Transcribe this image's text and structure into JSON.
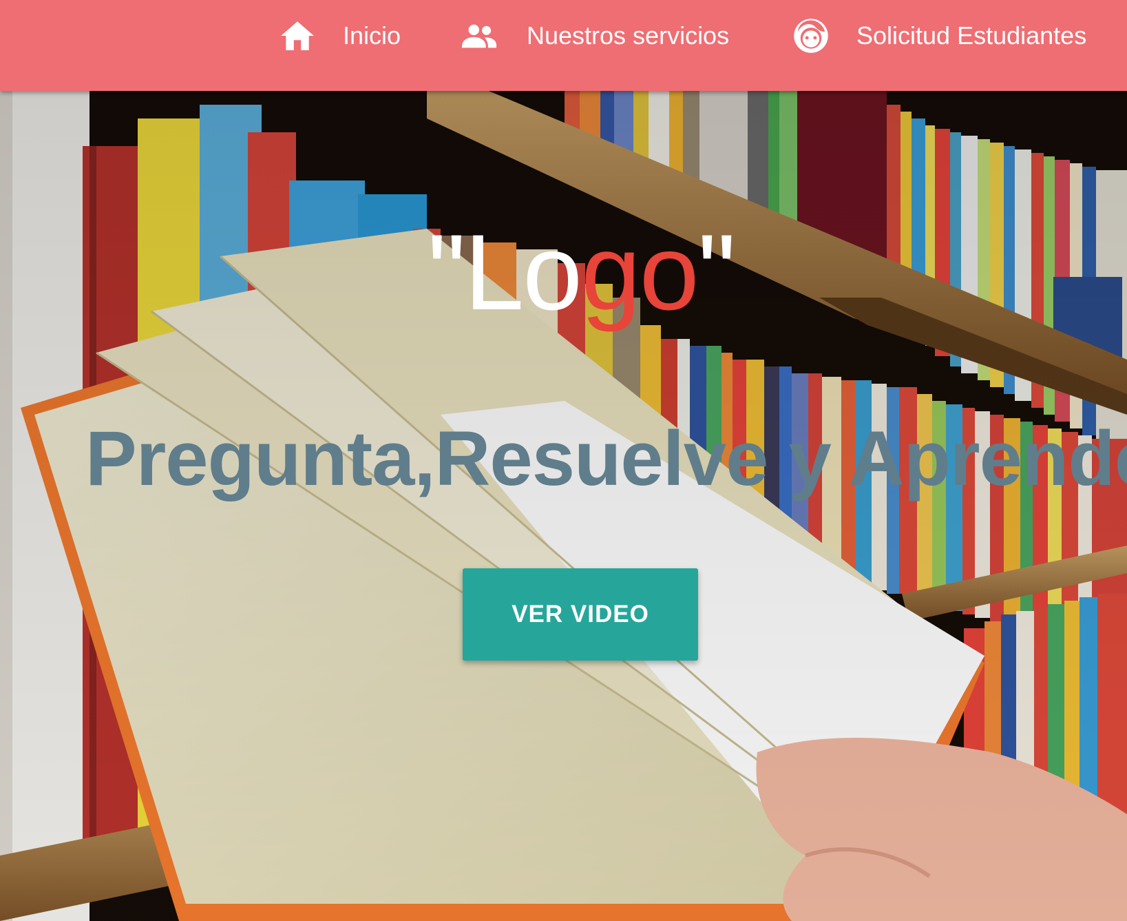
{
  "nav": {
    "items": [
      {
        "label": "Inicio",
        "icon": "home-icon"
      },
      {
        "label": "Nuestros servicios",
        "icon": "group-icon"
      },
      {
        "label": "Solicitud Estudiantes",
        "icon": "face-icon"
      }
    ]
  },
  "hero": {
    "title_open_quote": "\"",
    "title_white": "Lo",
    "title_red": "go",
    "title_close_quote": "\"",
    "subtitle": "Pregunta,Resuelve y Aprende.",
    "button_label": "VER VIDEO"
  },
  "colors": {
    "navbar": "#ee6e73",
    "title_white": "#ffffff",
    "title_red": "#e8443a",
    "subtitle": "#607d8b",
    "button": "#26a69a"
  }
}
